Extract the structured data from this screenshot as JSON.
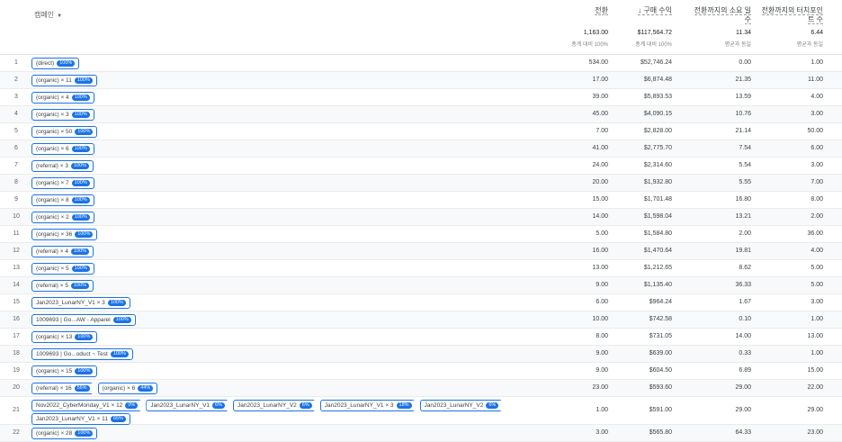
{
  "header": {
    "dimension_label": "캠페인",
    "metrics": [
      {
        "label": "전환",
        "total": "1,163.00",
        "sub": "총계 대비 100%"
      },
      {
        "label": "↓ 구매 수익",
        "total": "$117,564.72",
        "sub": "총계 대비 100%"
      },
      {
        "label_line1": "전환까지의 소요 일",
        "label_line2": "수",
        "total": "11.34",
        "sub": "평균과 동일"
      },
      {
        "label_line1": "전환까지의 터치포인",
        "label_line2": "트 수",
        "total": "6.44",
        "sub": "평균과 동일"
      }
    ]
  },
  "rows": [
    {
      "idx": "1",
      "path": [
        {
          "text": "(direct)",
          "badge": "100%"
        }
      ],
      "v": [
        "534.00",
        "$52,746.24",
        "0.00",
        "1.00"
      ]
    },
    {
      "idx": "2",
      "path": [
        {
          "text": "(organic) × 11",
          "badge": "100%"
        }
      ],
      "v": [
        "17.00",
        "$6,874.48",
        "21.35",
        "11.00"
      ]
    },
    {
      "idx": "3",
      "path": [
        {
          "text": "(organic) × 4",
          "badge": "100%"
        }
      ],
      "v": [
        "39.00",
        "$5,893.53",
        "13.59",
        "4.00"
      ]
    },
    {
      "idx": "4",
      "path": [
        {
          "text": "(organic) × 3",
          "badge": "100%"
        }
      ],
      "v": [
        "45.00",
        "$4,090.15",
        "10.76",
        "3.00"
      ]
    },
    {
      "idx": "5",
      "path": [
        {
          "text": "(organic) × 50",
          "badge": "100%"
        }
      ],
      "v": [
        "7.00",
        "$2,828.00",
        "21.14",
        "50.00"
      ]
    },
    {
      "idx": "6",
      "path": [
        {
          "text": "(organic) × 6",
          "badge": "100%"
        }
      ],
      "v": [
        "41.00",
        "$2,775.70",
        "7.54",
        "6.00"
      ]
    },
    {
      "idx": "7",
      "path": [
        {
          "text": "(referral) × 3",
          "badge": "100%"
        }
      ],
      "v": [
        "24.00",
        "$2,314.60",
        "5.54",
        "3.00"
      ]
    },
    {
      "idx": "8",
      "path": [
        {
          "text": "(organic) × 7",
          "badge": "100%"
        }
      ],
      "v": [
        "20.00",
        "$1,932.80",
        "5.55",
        "7.00"
      ]
    },
    {
      "idx": "9",
      "path": [
        {
          "text": "(organic) × 8",
          "badge": "100%"
        }
      ],
      "v": [
        "15.00",
        "$1,701.48",
        "16.80",
        "8.00"
      ]
    },
    {
      "idx": "10",
      "path": [
        {
          "text": "(organic) × 2",
          "badge": "100%"
        }
      ],
      "v": [
        "14.00",
        "$1,598.04",
        "13.21",
        "2.00"
      ]
    },
    {
      "idx": "11",
      "path": [
        {
          "text": "(organic) × 36",
          "badge": "100%"
        }
      ],
      "v": [
        "5.00",
        "$1,584.80",
        "2.00",
        "36.00"
      ]
    },
    {
      "idx": "12",
      "path": [
        {
          "text": "(referral) × 4",
          "badge": "100%"
        }
      ],
      "v": [
        "16.00",
        "$1,470.64",
        "19.81",
        "4.00"
      ]
    },
    {
      "idx": "13",
      "path": [
        {
          "text": "(organic) × 5",
          "badge": "100%"
        }
      ],
      "v": [
        "13.00",
        "$1,212.65",
        "8.62",
        "5.00"
      ]
    },
    {
      "idx": "14",
      "path": [
        {
          "text": "(referral) × 5",
          "badge": "100%"
        }
      ],
      "v": [
        "9.00",
        "$1,135.40",
        "36.33",
        "5.00"
      ]
    },
    {
      "idx": "15",
      "path": [
        {
          "text": "Jan2023_LunarNY_V1 × 3",
          "badge": "100%"
        }
      ],
      "v": [
        "6.00",
        "$964.24",
        "1.67",
        "3.00"
      ]
    },
    {
      "idx": "16",
      "path": [
        {
          "text": "1009693 | Go...AW - Apparel",
          "badge": "100%"
        }
      ],
      "v": [
        "10.00",
        "$742.58",
        "0.10",
        "1.00"
      ]
    },
    {
      "idx": "17",
      "path": [
        {
          "text": "(organic) × 13",
          "badge": "100%"
        }
      ],
      "v": [
        "8.00",
        "$731.05",
        "14.00",
        "13.00"
      ]
    },
    {
      "idx": "18",
      "path": [
        {
          "text": "1009693 | Go...oduct ~ Test",
          "badge": "100%"
        }
      ],
      "v": [
        "9.00",
        "$639.00",
        "0.33",
        "1.00"
      ]
    },
    {
      "idx": "19",
      "path": [
        {
          "text": "(organic) × 15",
          "badge": "100%"
        }
      ],
      "v": [
        "9.00",
        "$604.50",
        "6.89",
        "15.00"
      ]
    },
    {
      "idx": "20",
      "path": [
        {
          "text": "(referral) × 16",
          "badge": "56%",
          "arrow": true
        },
        {
          "text": "(organic) × 6",
          "badge": "44%"
        }
      ],
      "v": [
        "23.00",
        "$593.60",
        "29.00",
        "22.00"
      ]
    },
    {
      "idx": "21",
      "tall": true,
      "path": [
        {
          "text": "Nov2022_CyberMonday_V1 × 12",
          "badge": "0%",
          "arrow": true
        },
        {
          "text": "Jan2023_LunarNY_V1",
          "badge": "6%",
          "arrow": true
        },
        {
          "text": "Jan2023_LunarNY_V2",
          "badge": "6%",
          "arrow": true
        },
        {
          "text": "Jan2023_LunarNY_V1 × 3",
          "badge": "18%",
          "arrow": true
        },
        {
          "text": "Jan2023_LunarNY_V2",
          "badge": "6%",
          "arrow": true
        },
        {
          "text": "Jan2023_LunarNY_V1 × 11",
          "badge": "65%"
        }
      ],
      "v": [
        "1.00",
        "$591.00",
        "29.00",
        "29.00"
      ]
    },
    {
      "idx": "22",
      "path": [
        {
          "text": "(organic) × 28",
          "badge": "100%"
        }
      ],
      "v": [
        "3.00",
        "$565.80",
        "64.33",
        "23.00"
      ]
    }
  ],
  "colors": {
    "accent": "#1a73e8",
    "row_alt": "#f8f9fa",
    "border": "#e0e0e0"
  },
  "icons": {
    "sort_caret": "caret-down-icon"
  }
}
